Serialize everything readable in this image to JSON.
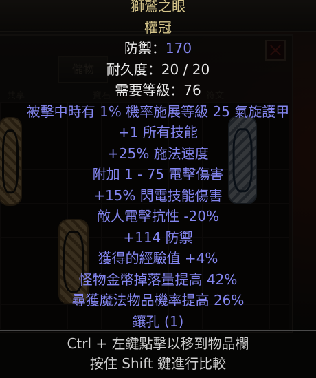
{
  "background": {
    "tabs": [
      "儲物"
    ],
    "columns": [
      "共享",
      "寶石",
      "符文"
    ]
  },
  "item": {
    "name": "獅鷲之眼",
    "base": "權冠",
    "defense_label": "防禦：",
    "defense_value": "170",
    "durability": "耐久度：20 / 20",
    "required_level": "需要等級：76",
    "mods": [
      "被擊中時有 1% 機率施展等級 25 氣旋護甲",
      "+1 所有技能",
      "+25% 施法速度",
      "附加 1 - 75 電擊傷害",
      "+15% 閃電技能傷害",
      "敵人電擊抗性 -20%",
      "+114 防禦",
      "獲得的經驗值 +4%",
      "怪物金幣掉落量提高 42%",
      "尋獲魔法物品機率提高 26%",
      "鑲孔 (1)"
    ]
  },
  "hints": {
    "move": "Ctrl + 左鍵點擊以移到物品欄",
    "compare": "按住 Shift 鍵進行比較"
  },
  "colors": {
    "unique_gold": "#d4c48a",
    "magic_blue": "#8486f0",
    "text_white": "#e8e8e8"
  }
}
